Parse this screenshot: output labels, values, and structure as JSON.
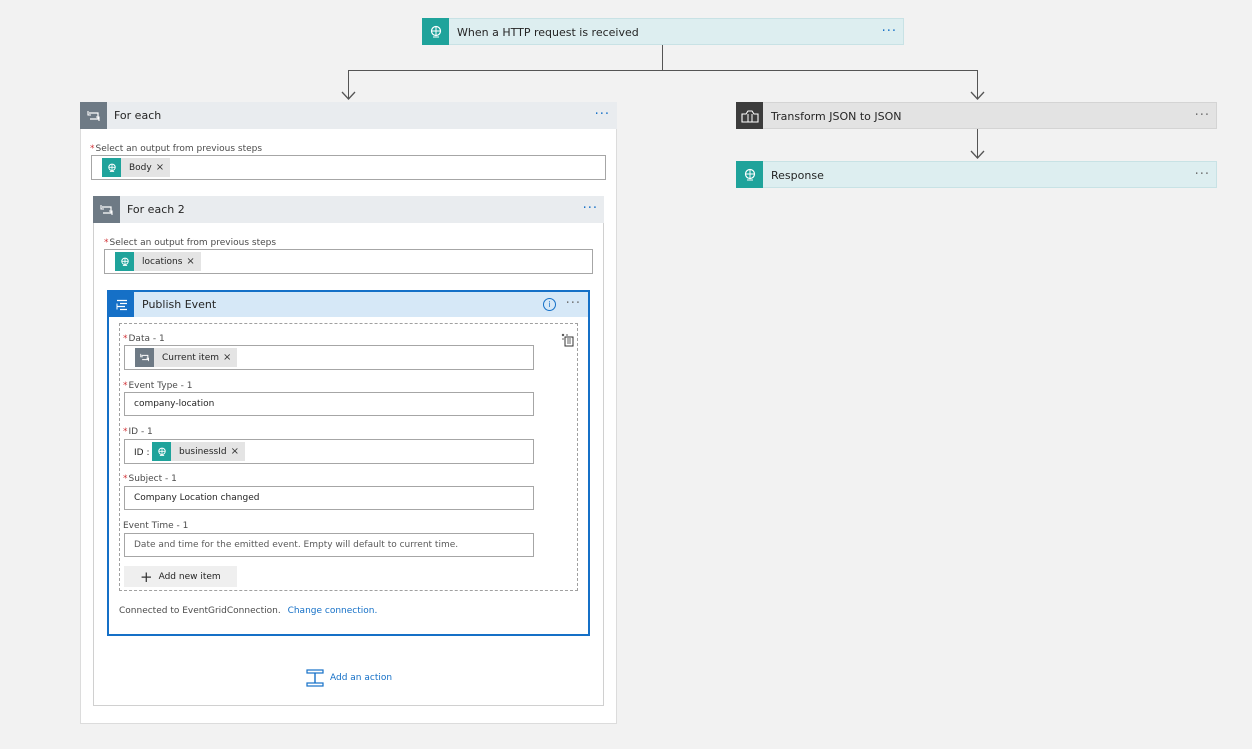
{
  "trigger": {
    "title": "When a HTTP request is received",
    "icon": "http-globe-icon",
    "menu": "···"
  },
  "foreach1": {
    "title": "For each",
    "menu": "···",
    "select_label": "Select an output from previous steps",
    "token": "Body",
    "token_remove": "×"
  },
  "foreach2": {
    "title": "For each 2",
    "menu": "···",
    "select_label": "Select an output from previous steps",
    "token": "locations",
    "token_remove": "×"
  },
  "publish": {
    "title": "Publish Event",
    "info": "i",
    "menu": "···",
    "fields": {
      "data_label": "Data - 1",
      "data_token": "Current item",
      "event_type_label": "Event Type - 1",
      "event_type_value": "company-location",
      "id_label": "ID - 1",
      "id_prefix": "ID :",
      "id_token": "businessId",
      "subject_label": "Subject - 1",
      "subject_value": "Company Location changed",
      "event_time_label": "Event Time - 1",
      "event_time_placeholder": "Date and time for the emitted event. Empty will default to current time."
    },
    "token_remove": "×",
    "add_item_label": "Add new item",
    "connected_text": "Connected to EventGridConnection.",
    "change_connection": "Change connection."
  },
  "add_action_label": "Add an action",
  "transform": {
    "title": "Transform JSON to JSON",
    "menu": "···"
  },
  "response": {
    "title": "Response",
    "menu": "···"
  },
  "colors": {
    "teal": "#1fa39b",
    "grey": "#6e7a85",
    "blue": "#1570c7",
    "required": "#d13438"
  }
}
